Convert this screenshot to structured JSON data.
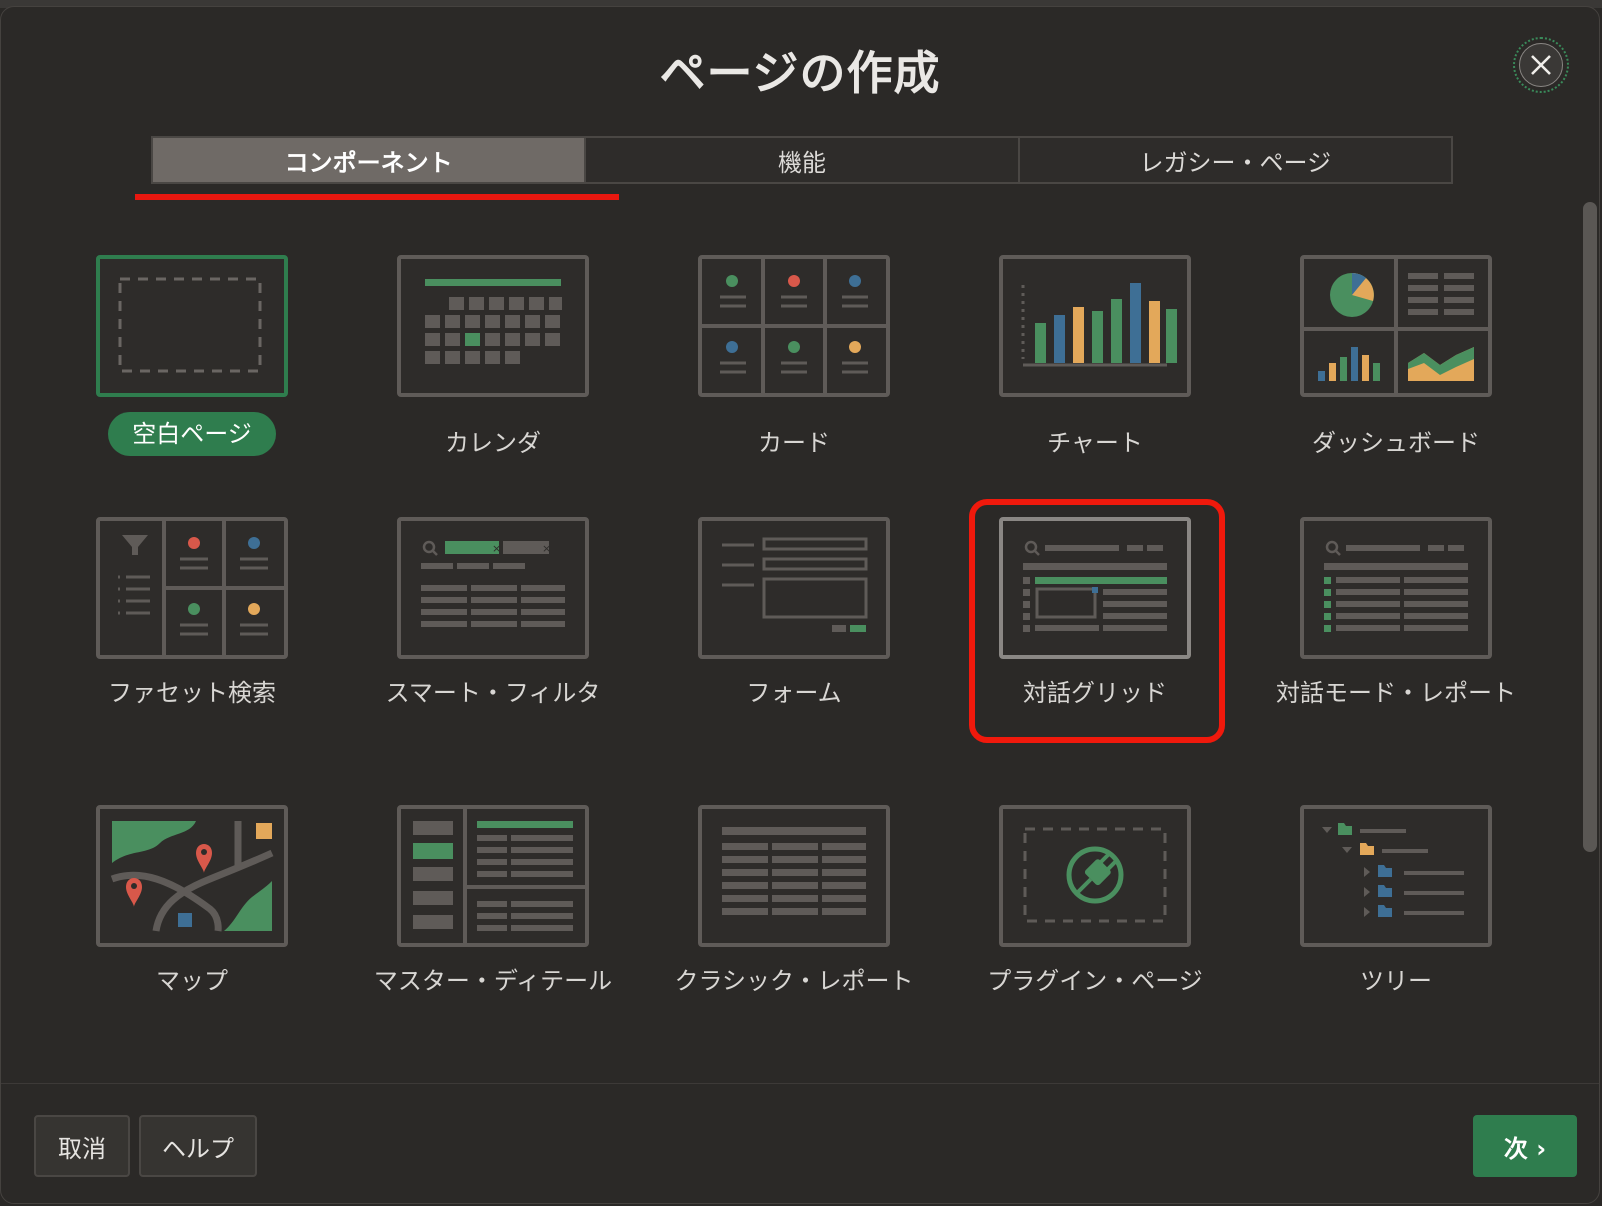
{
  "dialog": {
    "title": "ページの作成",
    "close_label": "×"
  },
  "tabs": [
    {
      "label": "コンポーネント",
      "active": true
    },
    {
      "label": "機能",
      "active": false
    },
    {
      "label": "レガシー・ページ",
      "active": false
    }
  ],
  "items": [
    {
      "label": "空白ページ",
      "icon": "blank-page-icon",
      "selected": true
    },
    {
      "label": "カレンダ",
      "icon": "calendar-icon"
    },
    {
      "label": "カード",
      "icon": "cards-icon"
    },
    {
      "label": "チャート",
      "icon": "chart-icon"
    },
    {
      "label": "ダッシュボード",
      "icon": "dashboard-icon"
    },
    {
      "label": "ファセット検索",
      "icon": "faceted-search-icon"
    },
    {
      "label": "スマート・フィルタ",
      "icon": "smart-filter-icon"
    },
    {
      "label": "フォーム",
      "icon": "form-icon"
    },
    {
      "label": "対話グリッド",
      "icon": "interactive-grid-icon",
      "highlighted": true
    },
    {
      "label": "対話モード・レポート",
      "icon": "interactive-report-icon"
    },
    {
      "label": "マップ",
      "icon": "map-icon"
    },
    {
      "label": "マスター・ディテール",
      "icon": "master-detail-icon"
    },
    {
      "label": "クラシック・レポート",
      "icon": "classic-report-icon"
    },
    {
      "label": "プラグイン・ページ",
      "icon": "plugin-page-icon"
    },
    {
      "label": "ツリー",
      "icon": "tree-icon"
    }
  ],
  "footer": {
    "cancel_label": "取消",
    "help_label": "ヘルプ",
    "next_label": "次 ›"
  },
  "colors": {
    "accent_green": "#2f7d4e",
    "highlight_red": "#f0190c",
    "icon_green": "#4a8f5f",
    "icon_blue": "#3e6f95",
    "icon_orange": "#e3a85a",
    "icon_red": "#d8584a"
  }
}
